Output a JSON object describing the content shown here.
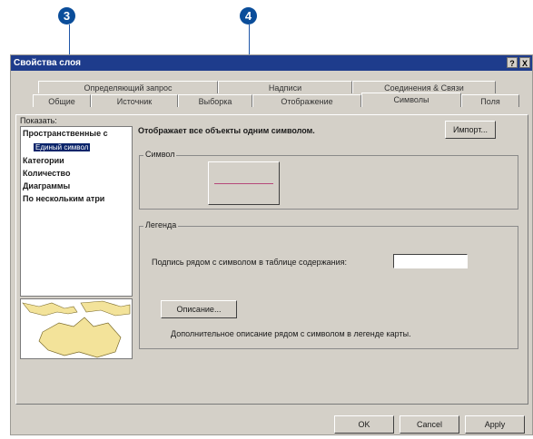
{
  "callouts": {
    "c3": "3",
    "c4": "4"
  },
  "window": {
    "title": "Свойства слоя",
    "help_label": "?",
    "close_label": "X"
  },
  "tabs_back": [
    "Определяющий запрос",
    "Надписи",
    "Соединения & Связи"
  ],
  "tabs_front": [
    "Общие",
    "Источник",
    "Выборка",
    "Отображение",
    "Символы",
    "Поля"
  ],
  "left": {
    "show_label": "Показать:",
    "tree": [
      "Пространственные с",
      "Единый символ",
      "Категории",
      "Количество",
      "Диаграммы",
      "По нескольким атри"
    ]
  },
  "main": {
    "headline": "Отображает все объекты одним символом.",
    "import_button": "Импорт...",
    "symbol_group": "Символ",
    "legend_group": "Легенда",
    "legend_label": "Подпись рядом с символом в таблице содержания:",
    "legend_value": "",
    "description_button": "Описание...",
    "description_note": "Дополнительное описание рядом с символом в легенде карты."
  },
  "footer": {
    "ok": "OK",
    "cancel": "Cancel",
    "apply": "Apply"
  },
  "colors": {
    "titlebar": "#1e3c8c",
    "selection": "#0a246a",
    "callout": "#0a4d9a",
    "symbol_line": "#b5487a"
  }
}
